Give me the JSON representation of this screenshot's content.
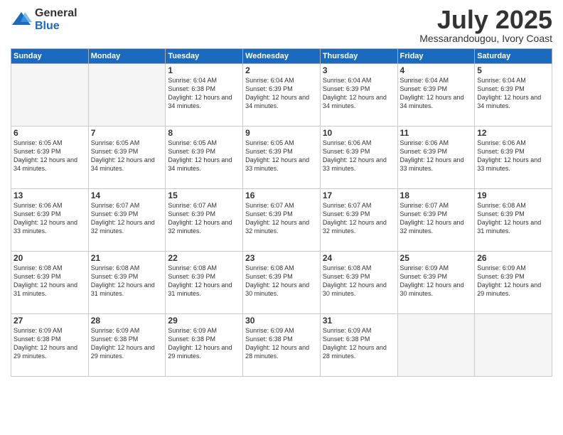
{
  "logo": {
    "general": "General",
    "blue": "Blue"
  },
  "header": {
    "month": "July 2025",
    "location": "Messarandougou, Ivory Coast"
  },
  "weekdays": [
    "Sunday",
    "Monday",
    "Tuesday",
    "Wednesday",
    "Thursday",
    "Friday",
    "Saturday"
  ],
  "weeks": [
    [
      {
        "day": "",
        "info": ""
      },
      {
        "day": "",
        "info": ""
      },
      {
        "day": "1",
        "info": "Sunrise: 6:04 AM\nSunset: 6:38 PM\nDaylight: 12 hours and 34 minutes."
      },
      {
        "day": "2",
        "info": "Sunrise: 6:04 AM\nSunset: 6:39 PM\nDaylight: 12 hours and 34 minutes."
      },
      {
        "day": "3",
        "info": "Sunrise: 6:04 AM\nSunset: 6:39 PM\nDaylight: 12 hours and 34 minutes."
      },
      {
        "day": "4",
        "info": "Sunrise: 6:04 AM\nSunset: 6:39 PM\nDaylight: 12 hours and 34 minutes."
      },
      {
        "day": "5",
        "info": "Sunrise: 6:04 AM\nSunset: 6:39 PM\nDaylight: 12 hours and 34 minutes."
      }
    ],
    [
      {
        "day": "6",
        "info": "Sunrise: 6:05 AM\nSunset: 6:39 PM\nDaylight: 12 hours and 34 minutes."
      },
      {
        "day": "7",
        "info": "Sunrise: 6:05 AM\nSunset: 6:39 PM\nDaylight: 12 hours and 34 minutes."
      },
      {
        "day": "8",
        "info": "Sunrise: 6:05 AM\nSunset: 6:39 PM\nDaylight: 12 hours and 34 minutes."
      },
      {
        "day": "9",
        "info": "Sunrise: 6:05 AM\nSunset: 6:39 PM\nDaylight: 12 hours and 33 minutes."
      },
      {
        "day": "10",
        "info": "Sunrise: 6:06 AM\nSunset: 6:39 PM\nDaylight: 12 hours and 33 minutes."
      },
      {
        "day": "11",
        "info": "Sunrise: 6:06 AM\nSunset: 6:39 PM\nDaylight: 12 hours and 33 minutes."
      },
      {
        "day": "12",
        "info": "Sunrise: 6:06 AM\nSunset: 6:39 PM\nDaylight: 12 hours and 33 minutes."
      }
    ],
    [
      {
        "day": "13",
        "info": "Sunrise: 6:06 AM\nSunset: 6:39 PM\nDaylight: 12 hours and 33 minutes."
      },
      {
        "day": "14",
        "info": "Sunrise: 6:07 AM\nSunset: 6:39 PM\nDaylight: 12 hours and 32 minutes."
      },
      {
        "day": "15",
        "info": "Sunrise: 6:07 AM\nSunset: 6:39 PM\nDaylight: 12 hours and 32 minutes."
      },
      {
        "day": "16",
        "info": "Sunrise: 6:07 AM\nSunset: 6:39 PM\nDaylight: 12 hours and 32 minutes."
      },
      {
        "day": "17",
        "info": "Sunrise: 6:07 AM\nSunset: 6:39 PM\nDaylight: 12 hours and 32 minutes."
      },
      {
        "day": "18",
        "info": "Sunrise: 6:07 AM\nSunset: 6:39 PM\nDaylight: 12 hours and 32 minutes."
      },
      {
        "day": "19",
        "info": "Sunrise: 6:08 AM\nSunset: 6:39 PM\nDaylight: 12 hours and 31 minutes."
      }
    ],
    [
      {
        "day": "20",
        "info": "Sunrise: 6:08 AM\nSunset: 6:39 PM\nDaylight: 12 hours and 31 minutes."
      },
      {
        "day": "21",
        "info": "Sunrise: 6:08 AM\nSunset: 6:39 PM\nDaylight: 12 hours and 31 minutes."
      },
      {
        "day": "22",
        "info": "Sunrise: 6:08 AM\nSunset: 6:39 PM\nDaylight: 12 hours and 31 minutes."
      },
      {
        "day": "23",
        "info": "Sunrise: 6:08 AM\nSunset: 6:39 PM\nDaylight: 12 hours and 30 minutes."
      },
      {
        "day": "24",
        "info": "Sunrise: 6:08 AM\nSunset: 6:39 PM\nDaylight: 12 hours and 30 minutes."
      },
      {
        "day": "25",
        "info": "Sunrise: 6:09 AM\nSunset: 6:39 PM\nDaylight: 12 hours and 30 minutes."
      },
      {
        "day": "26",
        "info": "Sunrise: 6:09 AM\nSunset: 6:39 PM\nDaylight: 12 hours and 29 minutes."
      }
    ],
    [
      {
        "day": "27",
        "info": "Sunrise: 6:09 AM\nSunset: 6:38 PM\nDaylight: 12 hours and 29 minutes."
      },
      {
        "day": "28",
        "info": "Sunrise: 6:09 AM\nSunset: 6:38 PM\nDaylight: 12 hours and 29 minutes."
      },
      {
        "day": "29",
        "info": "Sunrise: 6:09 AM\nSunset: 6:38 PM\nDaylight: 12 hours and 29 minutes."
      },
      {
        "day": "30",
        "info": "Sunrise: 6:09 AM\nSunset: 6:38 PM\nDaylight: 12 hours and 28 minutes."
      },
      {
        "day": "31",
        "info": "Sunrise: 6:09 AM\nSunset: 6:38 PM\nDaylight: 12 hours and 28 minutes."
      },
      {
        "day": "",
        "info": ""
      },
      {
        "day": "",
        "info": ""
      }
    ]
  ]
}
